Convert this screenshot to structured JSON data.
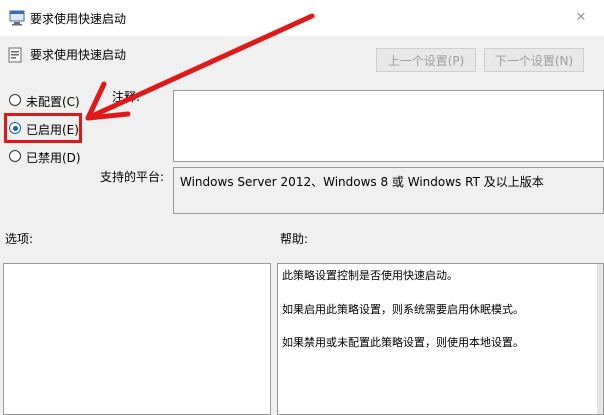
{
  "window": {
    "title": "要求使用快速启动",
    "close_glyph": "✕"
  },
  "header": {
    "title": "要求使用快速启动"
  },
  "nav": {
    "prev_label": "上一个设置(P)",
    "next_label": "下一个设置(N)"
  },
  "radios": [
    {
      "label": "未配置(C)",
      "checked": false
    },
    {
      "label": "已启用(E)",
      "checked": true
    },
    {
      "label": "已禁用(D)",
      "checked": false
    }
  ],
  "comment": {
    "label": "注释:",
    "value": ""
  },
  "platform": {
    "label": "支持的平台:",
    "value": "Windows Server 2012、Windows 8 或 Windows RT 及以上版本"
  },
  "options": {
    "label": "选项:"
  },
  "help": {
    "label": "帮助:",
    "lines": [
      "此策略设置控制是否使用快速启动。",
      "如果启用此策略设置，则系统需要启用休眠模式。",
      "如果禁用或未配置此策略设置，则使用本地设置。"
    ]
  },
  "annotation": {
    "color": "#e01818",
    "highlighted_option": "已启用(E)"
  }
}
